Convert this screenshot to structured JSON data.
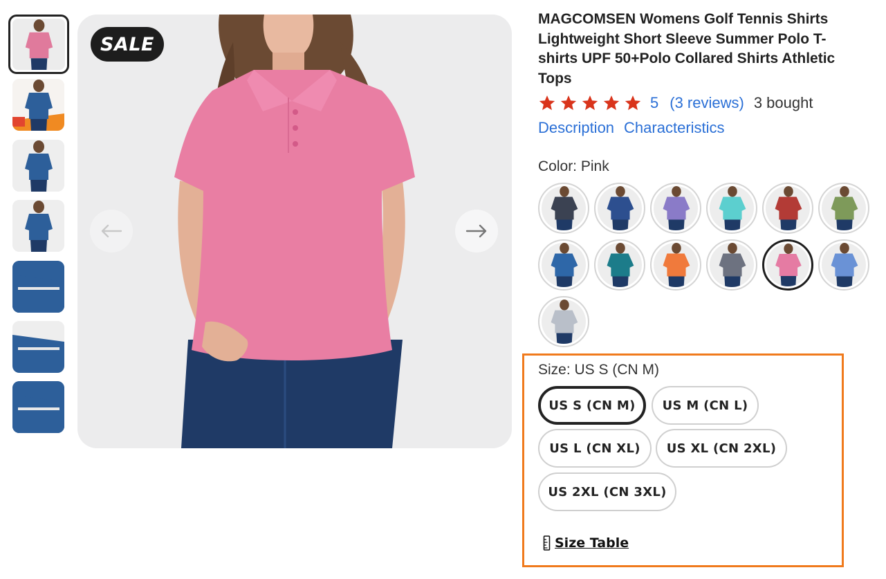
{
  "gallery": {
    "badge": "SALE",
    "thumbnails": [
      {
        "shirt_color": "#e07a9c",
        "bg": "#ececec",
        "kind": "model"
      },
      {
        "shirt_color": "#2d5f9a",
        "bg": "#f2f2f2",
        "kind": "promo"
      },
      {
        "shirt_color": "#2d5f9a",
        "bg": "#eeeeee",
        "kind": "model"
      },
      {
        "shirt_color": "#2d5f9a",
        "bg": "#eeeeee",
        "kind": "back"
      },
      {
        "shirt_color": "#2d5f9a",
        "bg": "#2d5f9a",
        "kind": "fabric"
      },
      {
        "shirt_color": "#2d5f9a",
        "bg": "#eeeeee",
        "kind": "fabric"
      },
      {
        "shirt_color": "#2d5f9a",
        "bg": "#2d5f9a",
        "kind": "fabric"
      }
    ],
    "main_shirt_color": "#e97ea3",
    "jeans_color": "#1f3a66"
  },
  "product": {
    "title": "MAGCOMSEN Womens Golf Tennis Shirts Lightweight Short Sleeve Summer Polo T-shirts UPF 50+Polo Collared Shirts Athletic Tops",
    "rating": "5",
    "reviews": "(3 reviews)",
    "bought": "3 bought",
    "star_color": "#d9341b",
    "links": [
      "Description",
      "Characteristics"
    ]
  },
  "color": {
    "label": "Color: Pink",
    "options": [
      {
        "name": "navy",
        "hex": "#3b4252"
      },
      {
        "name": "royal-blue",
        "hex": "#2d4f8f"
      },
      {
        "name": "purple",
        "hex": "#8a7bc8"
      },
      {
        "name": "aqua",
        "hex": "#5ccfcf"
      },
      {
        "name": "red",
        "hex": "#b33b36"
      },
      {
        "name": "green",
        "hex": "#7e9a5a"
      },
      {
        "name": "blue",
        "hex": "#2e67a8"
      },
      {
        "name": "teal",
        "hex": "#1c7c8a"
      },
      {
        "name": "orange",
        "hex": "#f07a3c"
      },
      {
        "name": "gray",
        "hex": "#6d7280"
      },
      {
        "name": "pink",
        "hex": "#e57ba3"
      },
      {
        "name": "light-blue",
        "hex": "#6a92d6"
      },
      {
        "name": "light-gray",
        "hex": "#b9bfc9"
      }
    ],
    "selected_index": 10
  },
  "size": {
    "label": "Size: US S (CN M)",
    "options": [
      "US S (CN M)",
      "US M (CN L)",
      "US L (CN XL)",
      "US XL (CN 2XL)",
      "US 2XL (CN 3XL)"
    ],
    "selected_index": 0,
    "size_table": "Size Table",
    "highlight_color": "#f07a1c"
  }
}
